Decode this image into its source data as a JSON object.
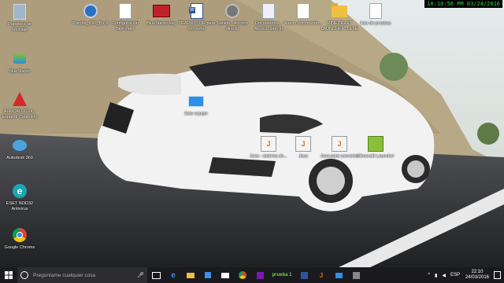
{
  "overlay_clock": "10:10:56 PM 03/24/2016",
  "desktop_icons_left": [
    {
      "label": "Papelera de reciclaje",
      "icon": "recycle-bin-icon"
    },
    {
      "label": "BlueStacks",
      "icon": "bluestacks-icon"
    },
    {
      "label": "AutoCAD 2014 - Español (Spanish)",
      "icon": "autocad-icon"
    },
    {
      "label": "Autodesk 360",
      "icon": "autodesk-360-icon"
    },
    {
      "label": "ESET NOD32 Antivirus",
      "icon": "eset-icon"
    },
    {
      "label": "Google Chrome",
      "icon": "chrome-icon"
    }
  ],
  "desktop_icons_top": [
    {
      "label": "Parche_IDM_By ®",
      "icon": "idm-patch-icon"
    },
    {
      "label": "Configuración BioFinder",
      "icon": "document-icon"
    },
    {
      "label": "BlueStacks.key",
      "icon": "key-icon"
    },
    {
      "label": "TRADUCTOR para converter",
      "icon": "word-doc-icon"
    },
    {
      "label": "Sonido - Acceso directo",
      "icon": "sound-shortcut-icon"
    },
    {
      "label": "Documentos - Acceso directo",
      "icon": "documents-shortcut-icon"
    },
    {
      "label": "Nuevo documento...",
      "icon": "document-icon"
    },
    {
      "label": "MINECRAFT LAUNCHER J.EXE",
      "icon": "folder-icon"
    },
    {
      "label": "lista de pruebas",
      "icon": "document-icon"
    }
  ],
  "desktop_icons_center": [
    {
      "label": "Este equipo",
      "icon": "monitor-icon"
    },
    {
      "label": "Java - sistema de...",
      "icon": "java-icon"
    },
    {
      "label": "Java",
      "icon": "java-icon"
    },
    {
      "label": "Java para converter",
      "icon": "java-icon"
    },
    {
      "label": "Minecraft Launcher",
      "icon": "minecraft-icon"
    }
  ],
  "taskbar": {
    "search_placeholder": "Pregúntame cualquier cosa",
    "tray_lang": "ESP",
    "tray_time": "22:10",
    "tray_date": "24/03/2016",
    "pinned_label": "prueba 1"
  },
  "colors": {
    "clock_text": "#31d44a",
    "taskbar": "#1a1a1e"
  }
}
